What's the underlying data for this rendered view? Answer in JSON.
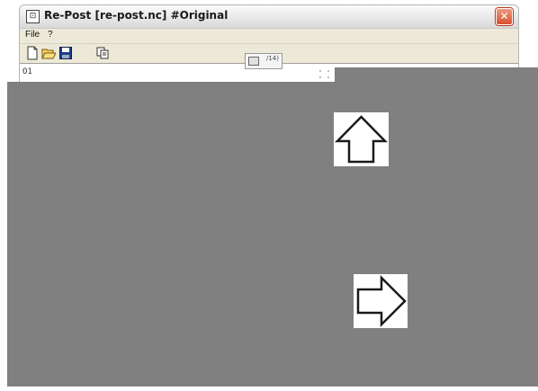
{
  "window": {
    "title": "Re-Post [re-post.nc] #Original",
    "close_glyph": "✕"
  },
  "menu": {
    "items": [
      {
        "label": "File"
      },
      {
        "label": "?"
      }
    ]
  },
  "toolbar": {
    "buttons": [
      {
        "icon": "new-file-icon"
      },
      {
        "icon": "open-folder-icon"
      },
      {
        "icon": "save-disk-icon"
      },
      {
        "icon": "copy-icon"
      }
    ]
  },
  "editor": {
    "first_line": "O1"
  },
  "floating_tool": {
    "label": "/14)"
  },
  "overlay": {
    "color": "#808080",
    "arrows": [
      {
        "icon": "arrow-up-icon"
      },
      {
        "icon": "arrow-right-icon"
      }
    ]
  }
}
